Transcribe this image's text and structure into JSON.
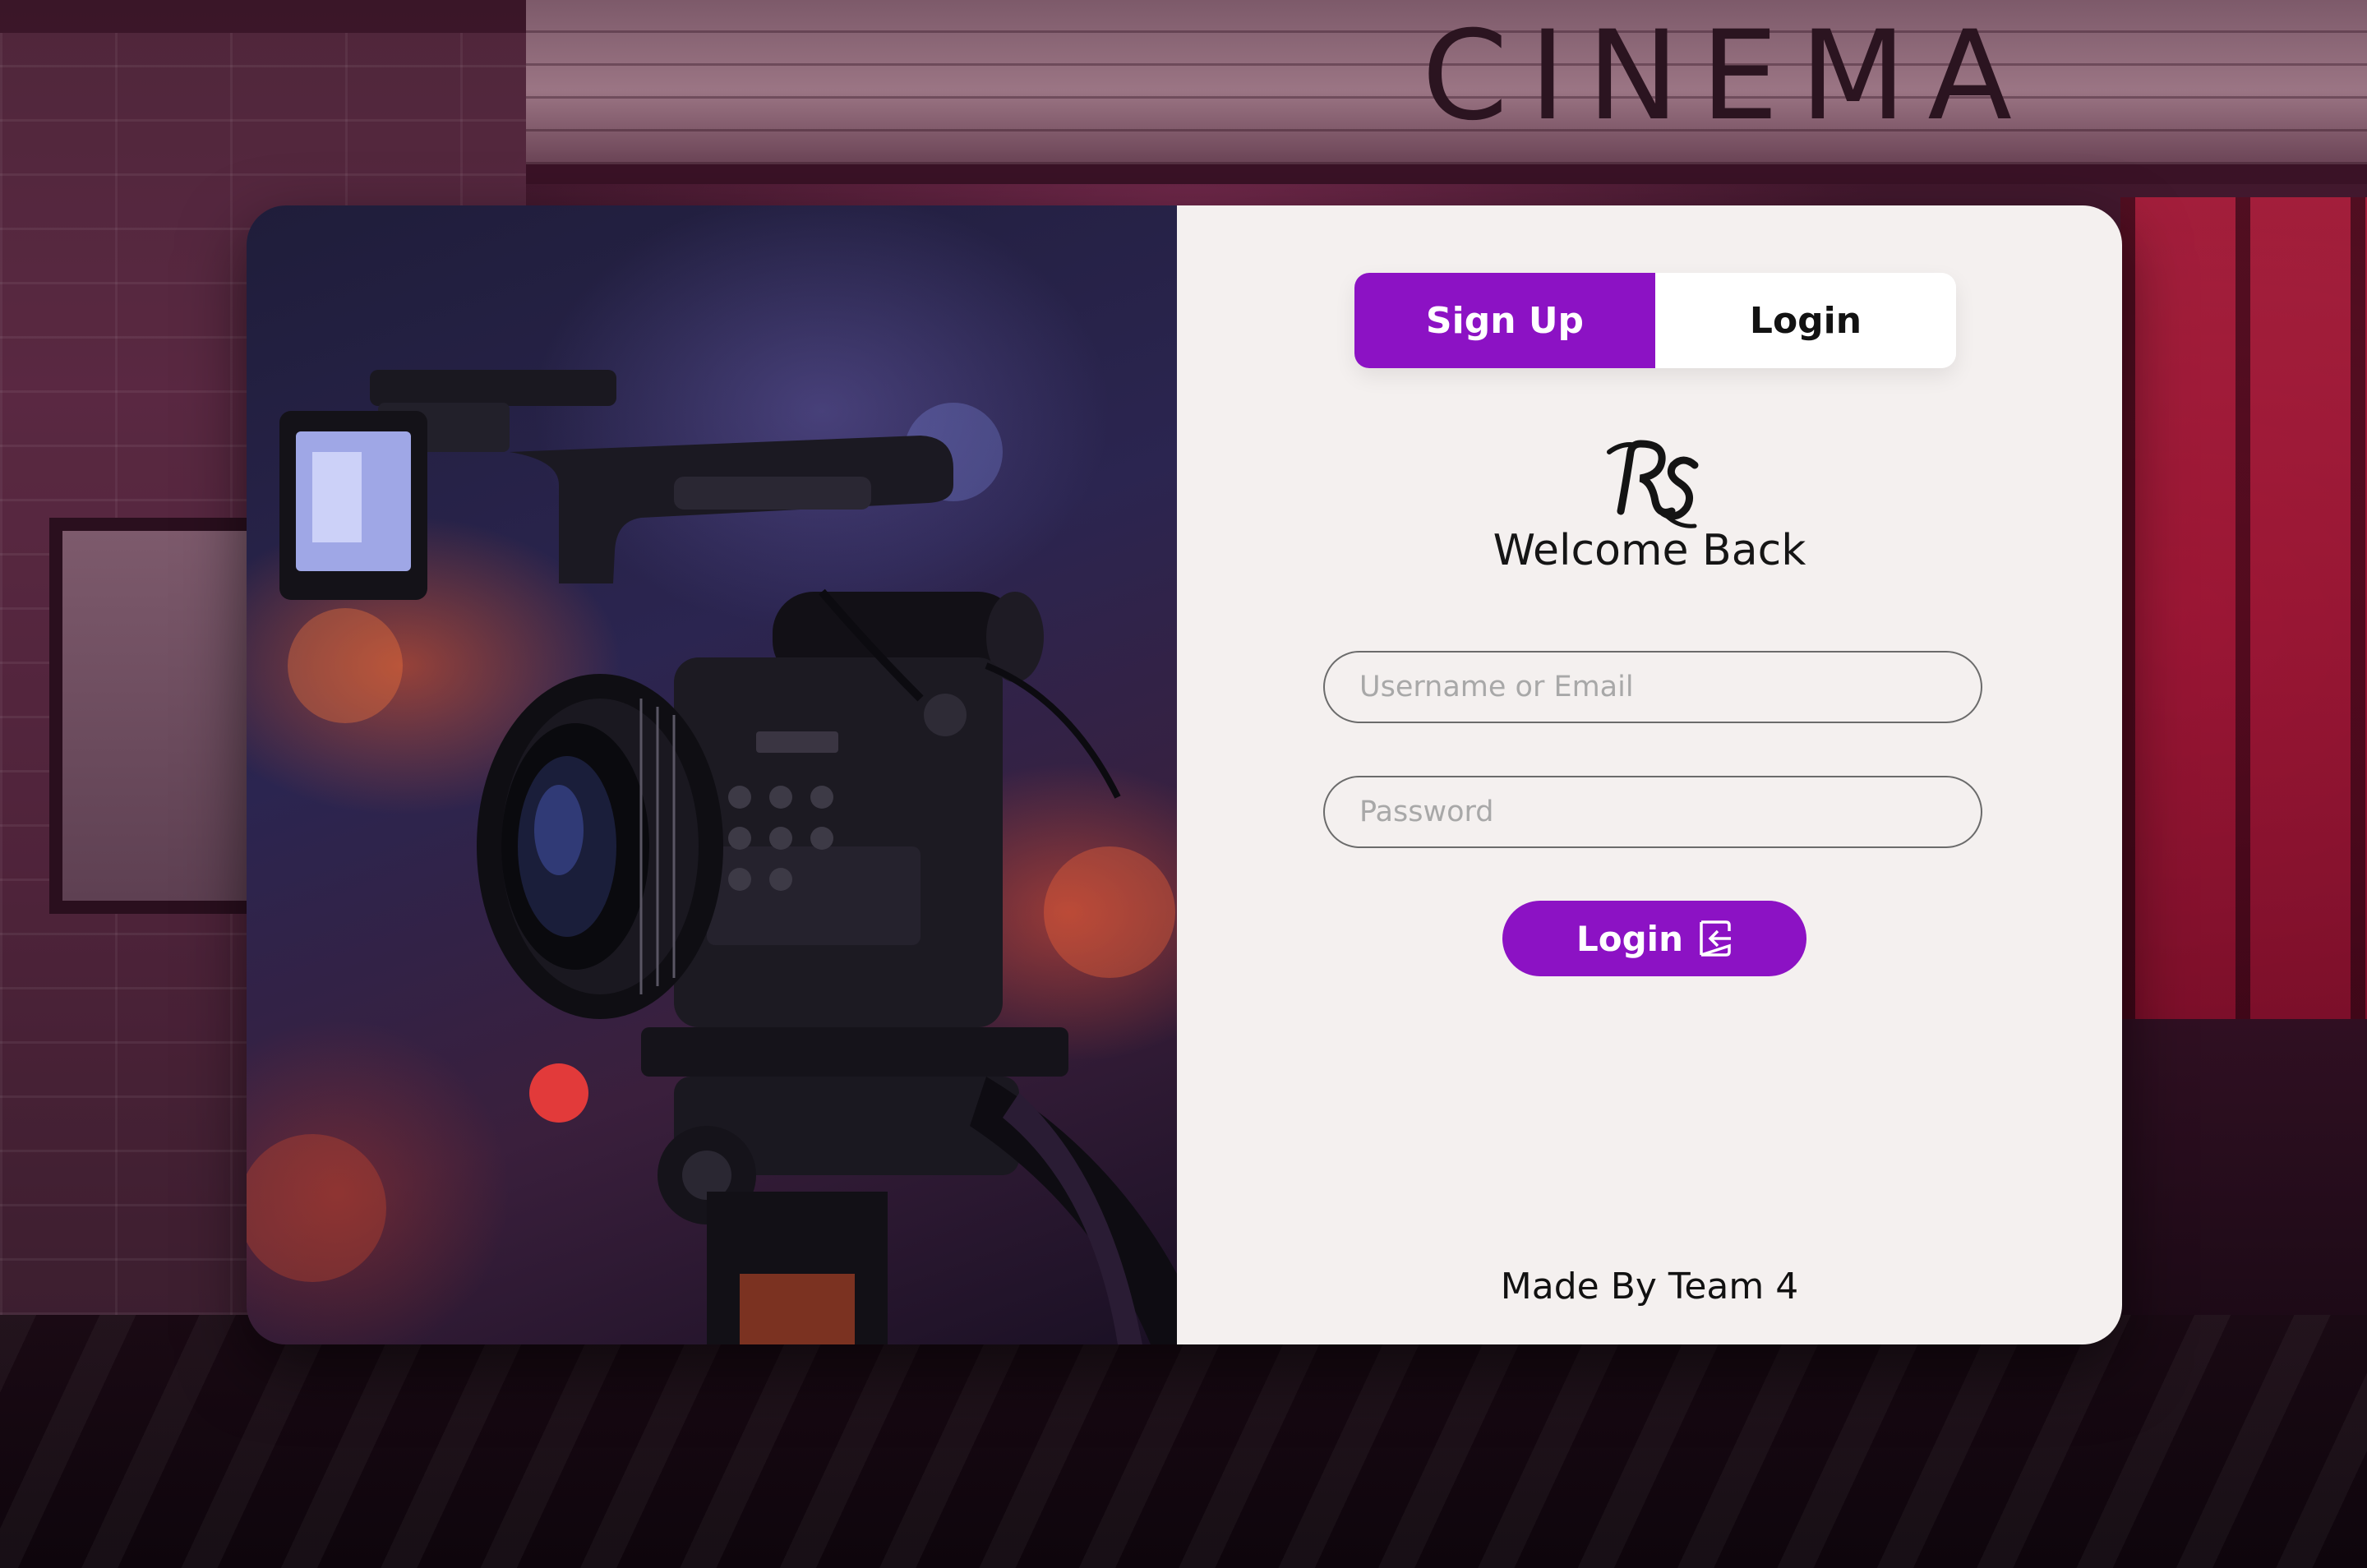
{
  "background": {
    "marquee_text": "CINEMA"
  },
  "auth_toggle": {
    "signup_label": "Sign Up",
    "login_label": "Login",
    "active": "Sign Up"
  },
  "brand": {
    "logo_text": "RS",
    "welcome_text": "Welcome Back"
  },
  "form": {
    "username_placeholder": "Username or Email",
    "password_placeholder": "Password",
    "username_value": "",
    "password_value": "",
    "submit_label": "Login",
    "submit_icon": "login-arrow-icon"
  },
  "footer": {
    "credit": "Made By Team 4"
  },
  "colors": {
    "accent": "#8c12c4",
    "panel_bg": "#f4f0ef",
    "text": "#151515",
    "placeholder": "#a8a8a8"
  }
}
